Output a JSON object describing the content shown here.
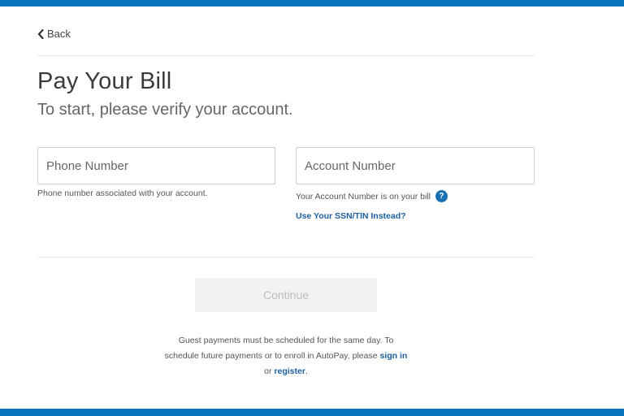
{
  "nav": {
    "back_label": "Back"
  },
  "header": {
    "title": "Pay Your Bill",
    "subtitle": "To start, please verify your account."
  },
  "form": {
    "phone": {
      "placeholder": "Phone Number",
      "value": "",
      "helper": "Phone number associated with your account."
    },
    "account": {
      "placeholder": "Account Number",
      "value": "",
      "helper": "Your Account Number is on your bill",
      "help_icon_label": "?"
    },
    "ssn_link": "Use Your SSN/TIN Instead?",
    "continue_label": "Continue"
  },
  "notice": {
    "text_1": "Guest payments must be scheduled for the same day. To schedule future payments or to enroll in AutoPay, please ",
    "sign_in": "sign in",
    "text_2": " or ",
    "register": "register",
    "text_3": "."
  },
  "colors": {
    "accent_bar": "#0b74bf",
    "link": "#1d5fa0",
    "help_icon": "#1a6fb3",
    "button_disabled_bg": "#f2f2f2"
  },
  "icons": {
    "back": "chevron-left-icon",
    "help": "question-circle-icon"
  }
}
